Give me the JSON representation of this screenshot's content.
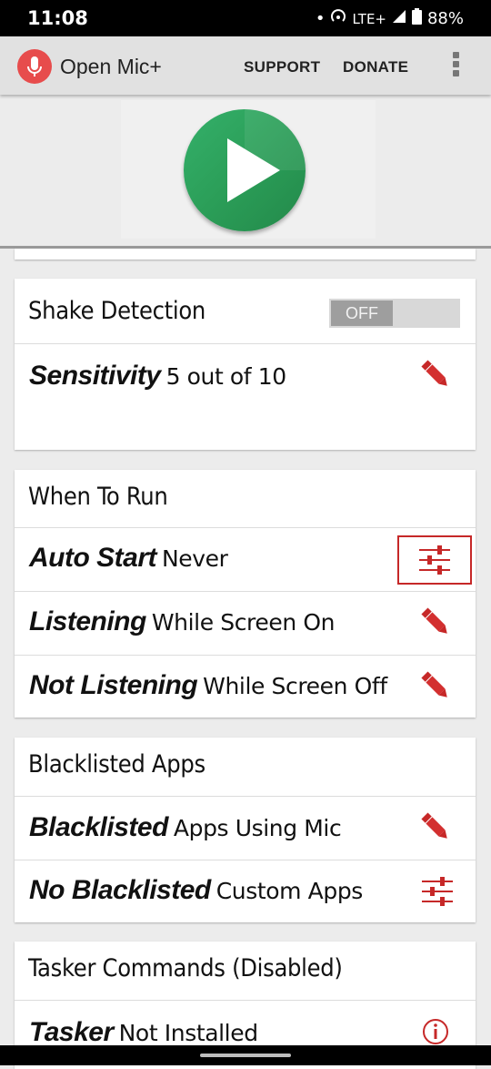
{
  "status_bar": {
    "time": "11:08",
    "network": "LTE+",
    "battery": "88%"
  },
  "app_bar": {
    "title": "Open Mic+",
    "support_label": "SUPPORT",
    "donate_label": "DONATE"
  },
  "shake_section": {
    "title": "Shake Detection",
    "toggle_value": "OFF",
    "sensitivity": {
      "label": "Sensitivity",
      "value": "5 out of 10"
    }
  },
  "when_section": {
    "title": "When To Run",
    "items": [
      {
        "label": "Auto Start",
        "value": "Never",
        "icon": "sliders-icon"
      },
      {
        "label": "Listening",
        "value": "While Screen On",
        "icon": "pencil-icon"
      },
      {
        "label": "Not Listening",
        "value": "While Screen Off",
        "icon": "pencil-icon"
      }
    ]
  },
  "blacklist_section": {
    "title": "Blacklisted Apps",
    "items": [
      {
        "label": "Blacklisted",
        "value": "Apps Using Mic",
        "icon": "pencil-icon"
      },
      {
        "label": "No Blacklisted",
        "value": "Custom Apps",
        "icon": "sliders-icon"
      }
    ]
  },
  "tasker_section": {
    "title": "Tasker Commands (Disabled)",
    "item": {
      "label": "Tasker",
      "value": "Not Installed",
      "icon": "info-icon"
    }
  },
  "colors": {
    "accent_red": "#c62828",
    "play_green": "#2b9e58",
    "mic_red": "#e74c4c"
  }
}
